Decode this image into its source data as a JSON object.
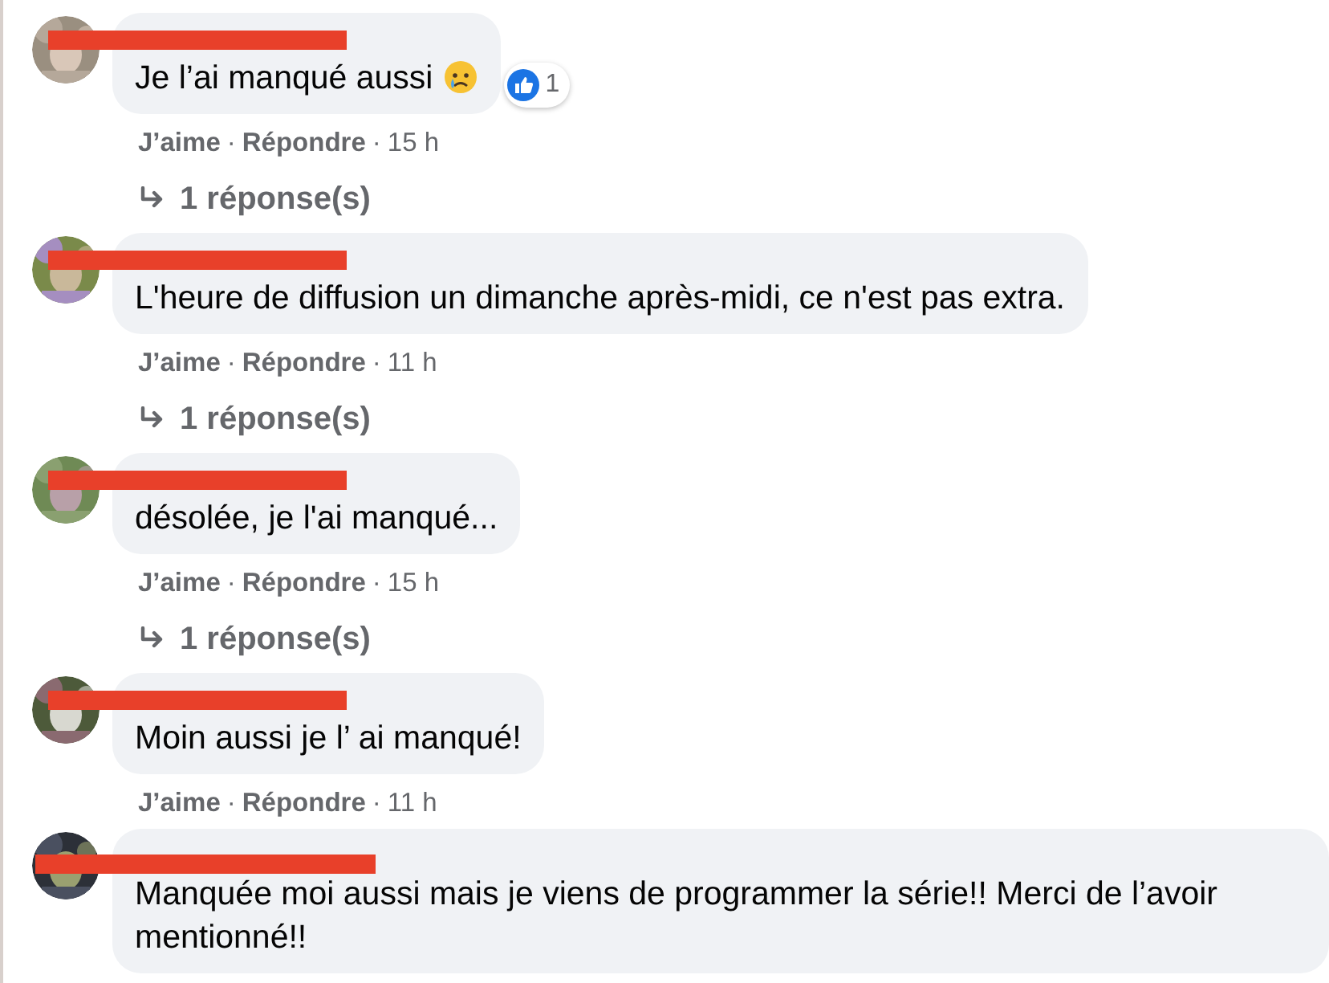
{
  "comments": [
    {
      "name_redacted": true,
      "text": "Je l’ai manqué aussi",
      "crying_emoji": true,
      "reactions": {
        "count": "1"
      },
      "actions": [
        {
          "kind": "link",
          "text": "J’aime"
        },
        {
          "kind": "dot",
          "text": "·"
        },
        {
          "kind": "link",
          "text": "Répondre"
        },
        {
          "kind": "dot",
          "text": "·"
        },
        {
          "kind": "time",
          "text": "15 h"
        }
      ],
      "replies": "1 réponse(s)"
    },
    {
      "name_redacted": true,
      "text": "L'heure de diffusion un dimanche après-midi, ce n'est pas extra.",
      "actions": [
        {
          "kind": "link",
          "text": "J’aime"
        },
        {
          "kind": "dot",
          "text": "·"
        },
        {
          "kind": "link",
          "text": "Répondre"
        },
        {
          "kind": "dot",
          "text": "·"
        },
        {
          "kind": "time",
          "text": "11 h"
        }
      ],
      "replies": "1 réponse(s)"
    },
    {
      "name_redacted": true,
      "text": "désolée, je l'ai manqué...",
      "actions": [
        {
          "kind": "link",
          "text": "J’aime"
        },
        {
          "kind": "dot",
          "text": "·"
        },
        {
          "kind": "link",
          "text": "Répondre"
        },
        {
          "kind": "dot",
          "text": "·"
        },
        {
          "kind": "time",
          "text": "15 h"
        }
      ],
      "replies": "1 réponse(s)"
    },
    {
      "name_redacted": true,
      "text": "Moin aussi je l’ ai manqué!",
      "actions": [
        {
          "kind": "link",
          "text": "J’aime"
        },
        {
          "kind": "dot",
          "text": "·"
        },
        {
          "kind": "link",
          "text": "Répondre"
        },
        {
          "kind": "dot",
          "text": "·"
        },
        {
          "kind": "time",
          "text": "11 h"
        }
      ]
    },
    {
      "name_redacted": true,
      "text": "Manquée moi aussi mais je viens de programmer la série!! Merci de l’avoir mentionné!!"
    }
  ]
}
